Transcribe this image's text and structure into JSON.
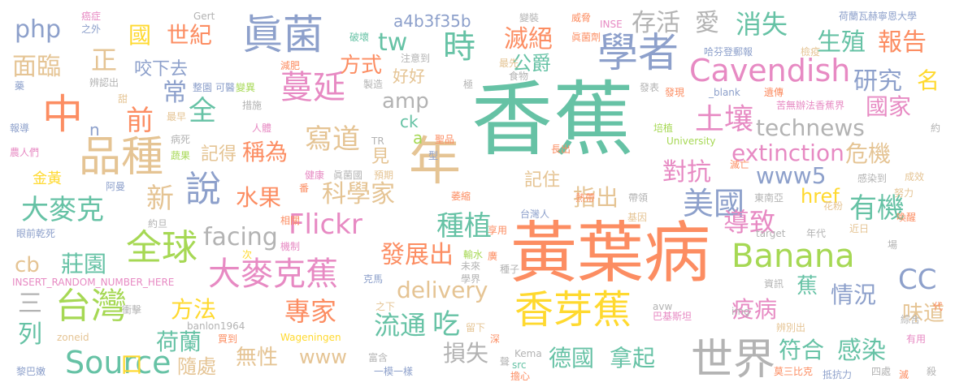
{
  "words": [
    {
      "text": "香蕉",
      "color": "#66c2a5"
    },
    {
      "text": "黃葉病",
      "color": "#fc8d62"
    },
    {
      "text": "年",
      "color": "#e5c494"
    },
    {
      "text": "香芽蕉",
      "color": "#ffd92f"
    },
    {
      "text": "眞菌",
      "color": "#8da0cb"
    },
    {
      "text": "學者",
      "color": "#8da0cb"
    },
    {
      "text": "世界",
      "color": "#b3b3b3"
    },
    {
      "text": "品種",
      "color": "#e5c494"
    },
    {
      "text": "中",
      "color": "#fc8d62"
    },
    {
      "text": "全球",
      "color": "#a6d854"
    },
    {
      "text": "台灣",
      "color": "#a6d854"
    },
    {
      "text": "說",
      "color": "#8da0cb"
    },
    {
      "text": "大麥克蕉",
      "color": "#e78ac3"
    },
    {
      "text": "Banana",
      "color": "#a6d854"
    },
    {
      "text": "Cavendish",
      "color": "#e78ac3"
    },
    {
      "text": "Flickr",
      "color": "#e78ac3"
    },
    {
      "text": "Source",
      "color": "#66c2a5"
    },
    {
      "text": "大麥克",
      "color": "#66c2a5"
    },
    {
      "text": "蔓延",
      "color": "#e78ac3"
    },
    {
      "text": "時",
      "color": "#66c2a5"
    },
    {
      "text": "美國",
      "color": "#8da0cb"
    },
    {
      "text": "土壤",
      "color": "#e78ac3"
    },
    {
      "text": "有機",
      "color": "#66c2a5"
    },
    {
      "text": "專家",
      "color": "#fc8d62"
    },
    {
      "text": "寫道",
      "color": "#e5c494"
    },
    {
      "text": "種植",
      "color": "#66c2a5"
    },
    {
      "text": "發展出",
      "color": "#fc8d62"
    },
    {
      "text": "流通",
      "color": "#66c2a5"
    },
    {
      "text": "吃",
      "color": "#66c2a5"
    },
    {
      "text": "科學家",
      "color": "#e5c494"
    },
    {
      "text": "delivery",
      "color": "#e5c494"
    },
    {
      "text": "facing",
      "color": "#b3b3b3"
    },
    {
      "text": "technews",
      "color": "#b3b3b3"
    },
    {
      "text": "extinction",
      "color": "#e78ac3"
    },
    {
      "text": "www5",
      "color": "#8da0cb"
    },
    {
      "text": "導致",
      "color": "#e78ac3"
    },
    {
      "text": "國家",
      "color": "#e78ac3"
    },
    {
      "text": "危機",
      "color": "#e5c494"
    },
    {
      "text": "對抗",
      "color": "#e78ac3"
    },
    {
      "text": "水果",
      "color": "#fc8d62"
    },
    {
      "text": "新",
      "color": "#e5c494"
    },
    {
      "text": "前",
      "color": "#fc8d62"
    },
    {
      "text": "全",
      "color": "#66c2a5"
    },
    {
      "text": "常",
      "color": "#8da0cb"
    },
    {
      "text": "正",
      "color": "#e5c494"
    },
    {
      "text": "面臨",
      "color": "#e5c494"
    },
    {
      "text": "國",
      "color": "#ffd92f"
    },
    {
      "text": "世紀",
      "color": "#fc8d62"
    },
    {
      "text": "php",
      "color": "#8da0cb"
    },
    {
      "text": "咬下去",
      "color": "#8da0cb"
    },
    {
      "text": "方式",
      "color": "#fc8d62"
    },
    {
      "text": "tw",
      "color": "#66c2a5"
    },
    {
      "text": "a4b3f35b",
      "color": "#8da0cb"
    },
    {
      "text": "存活",
      "color": "#b3b3b3"
    },
    {
      "text": "愛",
      "color": "#b3b3b3"
    },
    {
      "text": "消失",
      "color": "#66c2a5"
    },
    {
      "text": "生殖",
      "color": "#66c2a5"
    },
    {
      "text": "報告",
      "color": "#fc8d62"
    },
    {
      "text": "研究",
      "color": "#8da0cb"
    },
    {
      "text": "名",
      "color": "#ffd92f"
    },
    {
      "text": "滅絕",
      "color": "#fc8d62"
    },
    {
      "text": "公爵",
      "color": "#66c2a5"
    },
    {
      "text": "好好",
      "color": "#e5c494"
    },
    {
      "text": "amp",
      "color": "#b3b3b3"
    },
    {
      "text": "ck",
      "color": "#66c2a5"
    },
    {
      "text": "a",
      "color": "#a6d854"
    },
    {
      "text": "見",
      "color": "#e5c494"
    },
    {
      "text": "稱為",
      "color": "#fc8d62"
    },
    {
      "text": "記得",
      "color": "#e5c494"
    },
    {
      "text": "n",
      "color": "#8da0cb"
    },
    {
      "text": "記住",
      "color": "#e5c494"
    },
    {
      "text": "指出",
      "color": "#e5c494"
    },
    {
      "text": "href",
      "color": "#ffd92f"
    },
    {
      "text": "cb",
      "color": "#e5c494"
    },
    {
      "text": "莊園",
      "color": "#66c2a5"
    },
    {
      "text": "三",
      "color": "#b3b3b3"
    },
    {
      "text": "列",
      "color": "#66c2a5"
    },
    {
      "text": "方法",
      "color": "#ffd92f"
    },
    {
      "text": "荷蘭",
      "color": "#66c2a5"
    },
    {
      "text": "口",
      "color": "#ffd92f"
    },
    {
      "text": "隨處",
      "color": "#e5c494"
    },
    {
      "text": "無性",
      "color": "#e5c494"
    },
    {
      "text": "www",
      "color": "#e5c494"
    },
    {
      "text": "損失",
      "color": "#b3b3b3"
    },
    {
      "text": "德國",
      "color": "#66c2a5"
    },
    {
      "text": "拿起",
      "color": "#66c2a5"
    },
    {
      "text": "疫病",
      "color": "#e78ac3"
    },
    {
      "text": "情況",
      "color": "#8da0cb"
    },
    {
      "text": "蕉",
      "color": "#66c2a5"
    },
    {
      "text": "CC",
      "color": "#8da0cb"
    },
    {
      "text": "符合",
      "color": "#66c2a5"
    },
    {
      "text": "感染",
      "color": "#66c2a5"
    },
    {
      "text": "味道",
      "color": "#e5c494"
    },
    {
      "text": "金黃",
      "color": "#ffd92f"
    },
    {
      "text": "阿曼",
      "color": "#8da0cb"
    },
    {
      "text": "約旦",
      "color": "#b3b3b3"
    },
    {
      "text": "眼前乾死",
      "color": "#8da0cb"
    },
    {
      "text": "INSERT_RANDOM_NUMBER_HERE",
      "color": "#e78ac3"
    },
    {
      "text": "衝擊",
      "color": "#b3b3b3"
    },
    {
      "text": "黎巴嫩",
      "color": "#8da0cb"
    },
    {
      "text": "banlon1964",
      "color": "#b3b3b3"
    },
    {
      "text": "zoneid",
      "color": "#e5c494"
    },
    {
      "text": "Wageningen",
      "color": "#ffd92f"
    },
    {
      "text": "買到",
      "color": "#fc8d62"
    },
    {
      "text": "富含",
      "color": "#b3b3b3"
    },
    {
      "text": "一模一樣",
      "color": "#8da0cb"
    },
    {
      "text": "src",
      "color": "#66c2a5"
    },
    {
      "text": "擔心",
      "color": "#fc8d62"
    },
    {
      "text": "Kema",
      "color": "#b3b3b3"
    },
    {
      "text": "聲",
      "color": "#b3b3b3"
    },
    {
      "text": "深",
      "color": "#fc8d62"
    },
    {
      "text": "留下",
      "color": "#e5c494"
    },
    {
      "text": "之下",
      "color": "#e5c494"
    },
    {
      "text": "學界",
      "color": "#b3b3b3"
    },
    {
      "text": "克馬",
      "color": "#8da0cb"
    },
    {
      "text": "未來",
      "color": "#b3b3b3"
    },
    {
      "text": "輸水",
      "color": "#a6d854"
    },
    {
      "text": "廣",
      "color": "#fc8d62"
    },
    {
      "text": "種子",
      "color": "#b3b3b3"
    },
    {
      "text": "機制",
      "color": "#e78ac3"
    },
    {
      "text": "相關",
      "color": "#fc8d62"
    },
    {
      "text": "次",
      "color": "#ffd92f"
    },
    {
      "text": "享用",
      "color": "#fc8d62"
    },
    {
      "text": "台灣人",
      "color": "#8da0cb"
    },
    {
      "text": "熱帶",
      "color": "#fc8d62"
    },
    {
      "text": "基因",
      "color": "#e5c494"
    },
    {
      "text": "帶領",
      "color": "#b3b3b3"
    },
    {
      "text": "東南亞",
      "color": "#b3b3b3"
    },
    {
      "text": "花粉",
      "color": "#e5c494"
    },
    {
      "text": "喚醒",
      "color": "#fc8d62"
    },
    {
      "text": "努力",
      "color": "#e5c494"
    },
    {
      "text": "成效",
      "color": "#e5c494"
    },
    {
      "text": "感染到",
      "color": "#b3b3b3"
    },
    {
      "text": "近日",
      "color": "#e5c494"
    },
    {
      "text": "年代",
      "color": "#b3b3b3"
    },
    {
      "text": "場",
      "color": "#b3b3b3"
    },
    {
      "text": "target",
      "color": "#b3b3b3"
    },
    {
      "text": "資訊",
      "color": "#b3b3b3"
    },
    {
      "text": "img",
      "color": "#b3b3b3"
    },
    {
      "text": "avw",
      "color": "#b3b3b3"
    },
    {
      "text": "巴基斯坦",
      "color": "#e78ac3"
    },
    {
      "text": "綜合",
      "color": "#b3b3b3"
    },
    {
      "text": "辨別出",
      "color": "#e5c494"
    },
    {
      "text": "有用",
      "color": "#e78ac3"
    },
    {
      "text": "代",
      "color": "#fc8d62"
    },
    {
      "text": "莫三比克",
      "color": "#fc8d62"
    },
    {
      "text": "抵抗力",
      "color": "#8da0cb"
    },
    {
      "text": "四處",
      "color": "#b3b3b3"
    },
    {
      "text": "滅",
      "color": "#fc8d62"
    },
    {
      "text": "殺",
      "color": "#b3b3b3"
    },
    {
      "text": "報導",
      "color": "#8da0cb"
    },
    {
      "text": "農人們",
      "color": "#e78ac3"
    },
    {
      "text": "健康",
      "color": "#e78ac3"
    },
    {
      "text": "眞菌國",
      "color": "#b3b3b3"
    },
    {
      "text": "預期",
      "color": "#e5c494"
    },
    {
      "text": "番",
      "color": "#fc8d62"
    },
    {
      "text": "萎縮",
      "color": "#fc8d62"
    },
    {
      "text": "長出",
      "color": "#fc8d62"
    },
    {
      "text": "滅亡",
      "color": "#fc8d62"
    },
    {
      "text": "University",
      "color": "#a6d854"
    },
    {
      "text": "培植",
      "color": "#a6d854"
    },
    {
      "text": "約",
      "color": "#b3b3b3"
    },
    {
      "text": "聖品",
      "color": "#fc8d62"
    },
    {
      "text": "型",
      "color": "#8da0cb"
    },
    {
      "text": "TR",
      "color": "#b3b3b3"
    },
    {
      "text": "人體",
      "color": "#e78ac3"
    },
    {
      "text": "蔬果",
      "color": "#a6d854"
    },
    {
      "text": "病死",
      "color": "#b3b3b3"
    },
    {
      "text": "最早",
      "color": "#e5c494"
    },
    {
      "text": "措施",
      "color": "#b3b3b3"
    },
    {
      "text": "整園",
      "color": "#8da0cb"
    },
    {
      "text": "可醫",
      "color": "#8da0cb"
    },
    {
      "text": "變異",
      "color": "#a6d854"
    },
    {
      "text": "製造",
      "color": "#b3b3b3"
    },
    {
      "text": "極",
      "color": "#b3b3b3"
    },
    {
      "text": "食物",
      "color": "#b3b3b3"
    },
    {
      "text": "發表",
      "color": "#b3b3b3"
    },
    {
      "text": "發現",
      "color": "#fc8d62"
    },
    {
      "text": "_blank",
      "color": "#8da0cb"
    },
    {
      "text": "遺傳",
      "color": "#fc8d62"
    },
    {
      "text": "苦無辦法香蕉界",
      "color": "#e78ac3"
    },
    {
      "text": "甜",
      "color": "#e5c494"
    },
    {
      "text": "藥",
      "color": "#8da0cb"
    },
    {
      "text": "辨認出",
      "color": "#b3b3b3"
    },
    {
      "text": "癌症",
      "color": "#e78ac3"
    },
    {
      "text": "之外",
      "color": "#8da0cb"
    },
    {
      "text": "Gert",
      "color": "#b3b3b3"
    },
    {
      "text": "破壞",
      "color": "#66c2a5"
    },
    {
      "text": "減肥",
      "color": "#fc8d62"
    },
    {
      "text": "注意到",
      "color": "#b3b3b3"
    },
    {
      "text": "最先",
      "color": "#e5c494"
    },
    {
      "text": "變裝",
      "color": "#b3b3b3"
    },
    {
      "text": "眞菌劑",
      "color": "#fc8d62"
    },
    {
      "text": "威脅",
      "color": "#fc8d62"
    },
    {
      "text": "INSE",
      "color": "#e78ac3"
    },
    {
      "text": "荷蘭瓦赫寧恩大學",
      "color": "#8da0cb"
    },
    {
      "text": "哈芬登郵報",
      "color": "#8da0cb"
    },
    {
      "text": "檢疫",
      "color": "#e5c494"
    }
  ]
}
